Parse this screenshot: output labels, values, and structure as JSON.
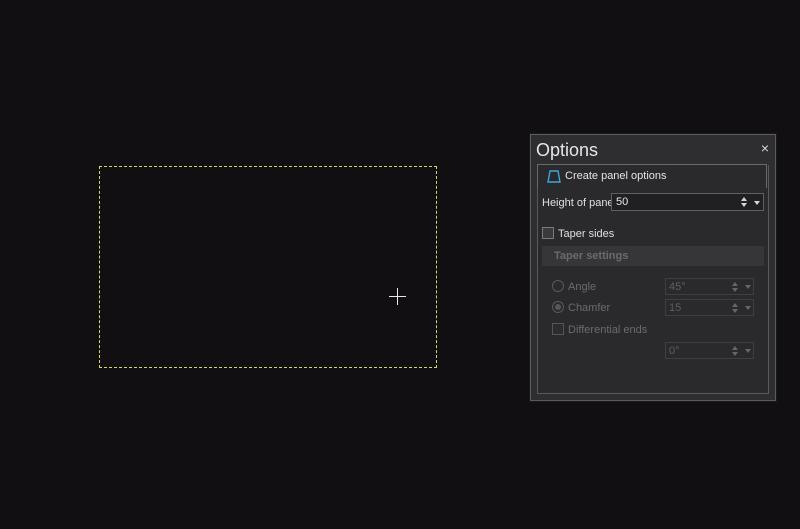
{
  "panel": {
    "title": "Options",
    "close_glyph": "×",
    "tab_label": "Create panel options",
    "tab_icon": "trapezoid-panel-icon"
  },
  "height": {
    "label": "Height of panel",
    "value": "50"
  },
  "taper": {
    "checkbox_label": "Taper sides",
    "checked": false,
    "settings_header": "Taper settings",
    "angle_label": "Angle",
    "angle_value": "45°",
    "chamfer_label": "Chamfer",
    "chamfer_value": "15",
    "chamfer_selected": true,
    "differential_label": "Differential ends",
    "differential_value": "0°"
  },
  "colors": {
    "background": "#110f11",
    "selection_dash": "#d8d46a",
    "panel_bg": "#2e2d2f",
    "icon_accent": "#3aa7d8"
  }
}
